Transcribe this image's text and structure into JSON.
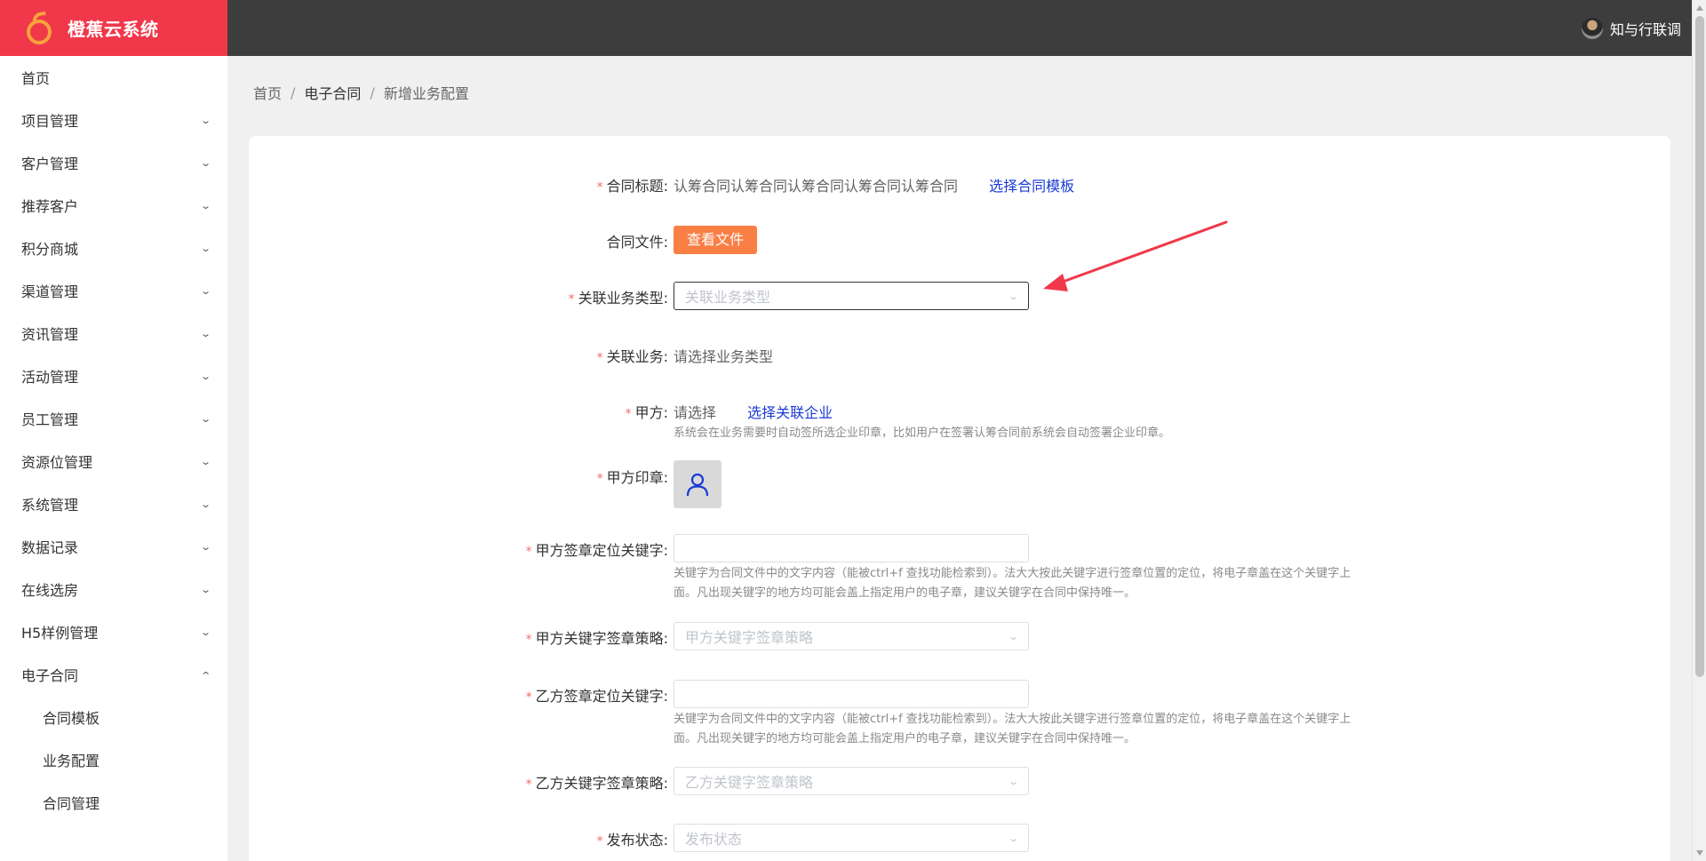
{
  "app": {
    "title": "橙蕉云系统"
  },
  "user": {
    "name": "知与行联调"
  },
  "sidebar": {
    "home": "首页",
    "items": [
      {
        "label": "项目管理"
      },
      {
        "label": "客户管理"
      },
      {
        "label": "推荐客户"
      },
      {
        "label": "积分商城"
      },
      {
        "label": "渠道管理"
      },
      {
        "label": "资讯管理"
      },
      {
        "label": "活动管理"
      },
      {
        "label": "员工管理"
      },
      {
        "label": "资源位管理"
      },
      {
        "label": "系统管理"
      },
      {
        "label": "数据记录"
      },
      {
        "label": "在线选房"
      },
      {
        "label": "H5样例管理"
      },
      {
        "label": "电子合同"
      }
    ],
    "submenu": [
      {
        "label": "合同模板"
      },
      {
        "label": "业务配置"
      },
      {
        "label": "合同管理"
      }
    ]
  },
  "breadcrumb": {
    "home": "首页",
    "section": "电子合同",
    "current": "新增业务配置",
    "separator": "/"
  },
  "form": {
    "required_mark": "*",
    "title": {
      "label": "合同标题:",
      "value": "认筹合同认筹合同认筹合同认筹合同认筹合同",
      "link": "选择合同模板"
    },
    "file": {
      "label": "合同文件:",
      "button": "查看文件"
    },
    "business_type": {
      "label": "关联业务类型:",
      "placeholder": "关联业务类型"
    },
    "business": {
      "label": "关联业务:",
      "value": "请选择业务类型"
    },
    "party_a": {
      "label": "甲方:",
      "value": "请选择",
      "link": "选择关联企业",
      "hint": "系统会在业务需要时自动签所选企业印章，比如用户在签署认筹合同前系统会自动签署企业印章。"
    },
    "party_a_seal": {
      "label": "甲方印章:"
    },
    "party_a_keyword": {
      "label": "甲方签章定位关键字:",
      "value": "",
      "hint": "关键字为合同文件中的文字内容（能被ctrl+f 查找功能检索到）。法大大按此关键字进行签章位置的定位，将电子章盖在这个关键字上面。凡出现关键字的地方均可能会盖上指定用户的电子章，建议关键字在合同中保持唯一。"
    },
    "party_a_strategy": {
      "label": "甲方关键字签章策略:",
      "placeholder": "甲方关键字签章策略"
    },
    "party_b_keyword": {
      "label": "乙方签章定位关键字:",
      "value": "",
      "hint": "关键字为合同文件中的文字内容（能被ctrl+f 查找功能检索到）。法大大按此关键字进行签章位置的定位，将电子章盖在这个关键字上面。凡出现关键字的地方均可能会盖上指定用户的电子章，建议关键字在合同中保持唯一。"
    },
    "party_b_strategy": {
      "label": "乙方关键字签章策略:",
      "placeholder": "乙方关键字签章策略"
    },
    "publish_status": {
      "label": "发布状态:",
      "placeholder": "发布状态"
    }
  },
  "colors": {
    "brand": "#f0384a",
    "topbar": "#3d3d3d",
    "link": "#1a3bd6",
    "button": "#f97f45",
    "required": "#f56c6c",
    "annotation_arrow": "#f0384a"
  }
}
